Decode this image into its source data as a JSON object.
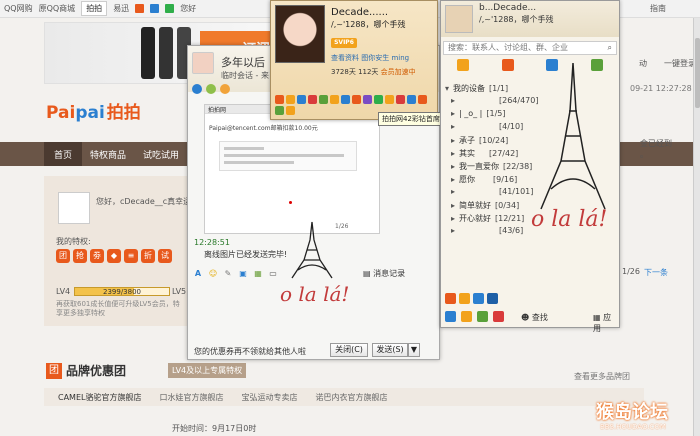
{
  "background_page": {
    "topbar": {
      "links": [
        "QQ网购",
        "原QQ商城"
      ],
      "tab_paipai": "拍拍",
      "tab_yixun": "易迅",
      "greeting": "您好",
      "right_link": "拍拍",
      "far_right": "指南"
    },
    "banner_text": "订阅10.20",
    "logo": {
      "latin_p": "Pai",
      "latin_b": "pai",
      "cn": "拍拍"
    },
    "nav": {
      "home": "首页",
      "special": "特权商品",
      "trial": "试吃试用"
    },
    "user_panel": {
      "greeting": "您好，cDecade__c真幸运",
      "privileges_label": "我的特权:",
      "privilege_icons": [
        "团",
        "抢",
        "劵",
        "◆",
        "≡",
        "折",
        "试"
      ],
      "lv_current": "LV4",
      "lv_progress": "2399/3800",
      "lv_progress_fraction": 0.63,
      "lv_next": "LV5",
      "lv_desc": "再获取601成长值便可升级LV5会员，特享更多独享特权"
    },
    "brand_group": {
      "badge": "团",
      "title": "品牌优惠团",
      "lv_tag": "LV4及以上专属特权",
      "more_link": "查看更多品牌团",
      "tabs": [
        "CAMEL骆驼官方旗舰店",
        "口水娃官方旗舰店",
        "宝弘运动专卖店",
        "诺巴内衣官方旗舰店"
      ],
      "start_time": "开始时间：9月17日0时"
    },
    "right_side": {
      "link1": "动",
      "link2": "一键登录",
      "date": "09-21 12:27:28",
      "text_lines": [
        "金已经到",
        "。"
      ],
      "page_count": "1/26",
      "next_page": "下一条"
    },
    "watermark": "猴岛论坛",
    "watermark_url": "BBS.HOUDAO.COM"
  },
  "chat_window": {
    "title": "多年以后",
    "subtitle": "临时会话 - 来",
    "screenshot": {
      "header": "拍拍网",
      "line1": "Paipai@tencent.com邮箱扣款10.00元",
      "footer": "1/26"
    },
    "time": "12:28:51",
    "sent_status": "离线图片已经发送完毕!",
    "history_label": "消息记录",
    "ad_text": "您的优惠券再不领就给其他人啦",
    "close_label": "关闭(C)",
    "send_label": "发送(S)",
    "send_arrow": "▼",
    "toolbar_icons": [
      "font-icon",
      "emoji-icon",
      "edit-icon",
      "image-icon",
      "picture-icon",
      "screen-icon"
    ],
    "sticker_text": "o la lá!"
  },
  "profile_popup": {
    "name": "Decade......",
    "signature": "/,~'1288，哪个手残",
    "badge": "SVIP6",
    "links": [
      "查看资料",
      "图你安生",
      "ming"
    ],
    "points": "3728天",
    "days": "112天",
    "member_note": "会员加速中",
    "tooltip": "拍拍网42彩钻首席"
  },
  "qq_panel": {
    "name": "b...Decade...",
    "signature": "/,~'1288，哪个手残",
    "search_placeholder": "搜索：联系人、讨论组、群、企业",
    "groups": [
      {
        "name": "我的设备",
        "count": "[1/1]",
        "open": true
      },
      {
        "name": "",
        "count": "[264/470]"
      },
      {
        "name": "| _o_ |",
        "count": "[1/5]"
      },
      {
        "name": "",
        "count": "[4/10]"
      },
      {
        "name": "承子",
        "count": "[10/24]"
      },
      {
        "name": "其实",
        "count": "[27/42]"
      },
      {
        "name": "我一直爱你",
        "count": "[22/38]"
      },
      {
        "name": "愿你",
        "count": "[9/16]"
      },
      {
        "name": "",
        "count": "[41/101]"
      },
      {
        "name": "简单就好",
        "count": "[0/34]"
      },
      {
        "name": "开心就好",
        "count": "[12/21]"
      },
      {
        "name": "",
        "count": "[43/6]"
      }
    ],
    "find_label": "查找",
    "app_label": "应用",
    "sticker_text": "o la lá!"
  }
}
